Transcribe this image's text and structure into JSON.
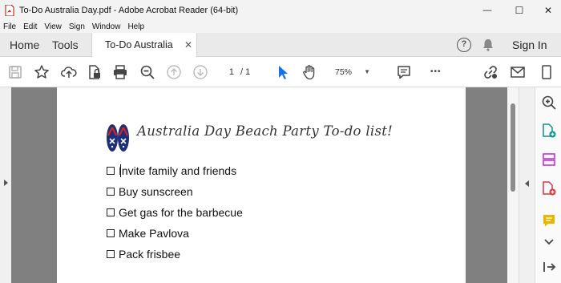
{
  "window": {
    "title": "To-Do Australia Day.pdf - Adobe Acrobat Reader (64-bit)",
    "minimize_glyph": "—",
    "maximize_glyph": "☐",
    "close_glyph": "✕"
  },
  "menu": {
    "items": [
      "File",
      "Edit",
      "View",
      "Sign",
      "Window",
      "Help"
    ]
  },
  "tabs": {
    "home": "Home",
    "tools": "Tools",
    "document": "To-Do Australia Da...",
    "close_glyph": "✕",
    "help_glyph": "?",
    "sign_in": "Sign In"
  },
  "toolbar": {
    "page_current": "1",
    "page_total": "/ 1",
    "zoom": "75%",
    "zoom_caret": "▼",
    "more_glyph": "•••"
  },
  "document": {
    "heading": "Australia Day Beach Party To-do list!",
    "items": [
      "Invite family and friends",
      "Buy sunscreen",
      "Get gas for the barbecue",
      "Make Pavlova",
      "Pack frisbee"
    ]
  },
  "colors": {
    "accent_blue": "#1473e6",
    "acrobat_red": "#d7373f",
    "comment_yellow": "#e8b600",
    "canvas_gray": "#808080"
  }
}
